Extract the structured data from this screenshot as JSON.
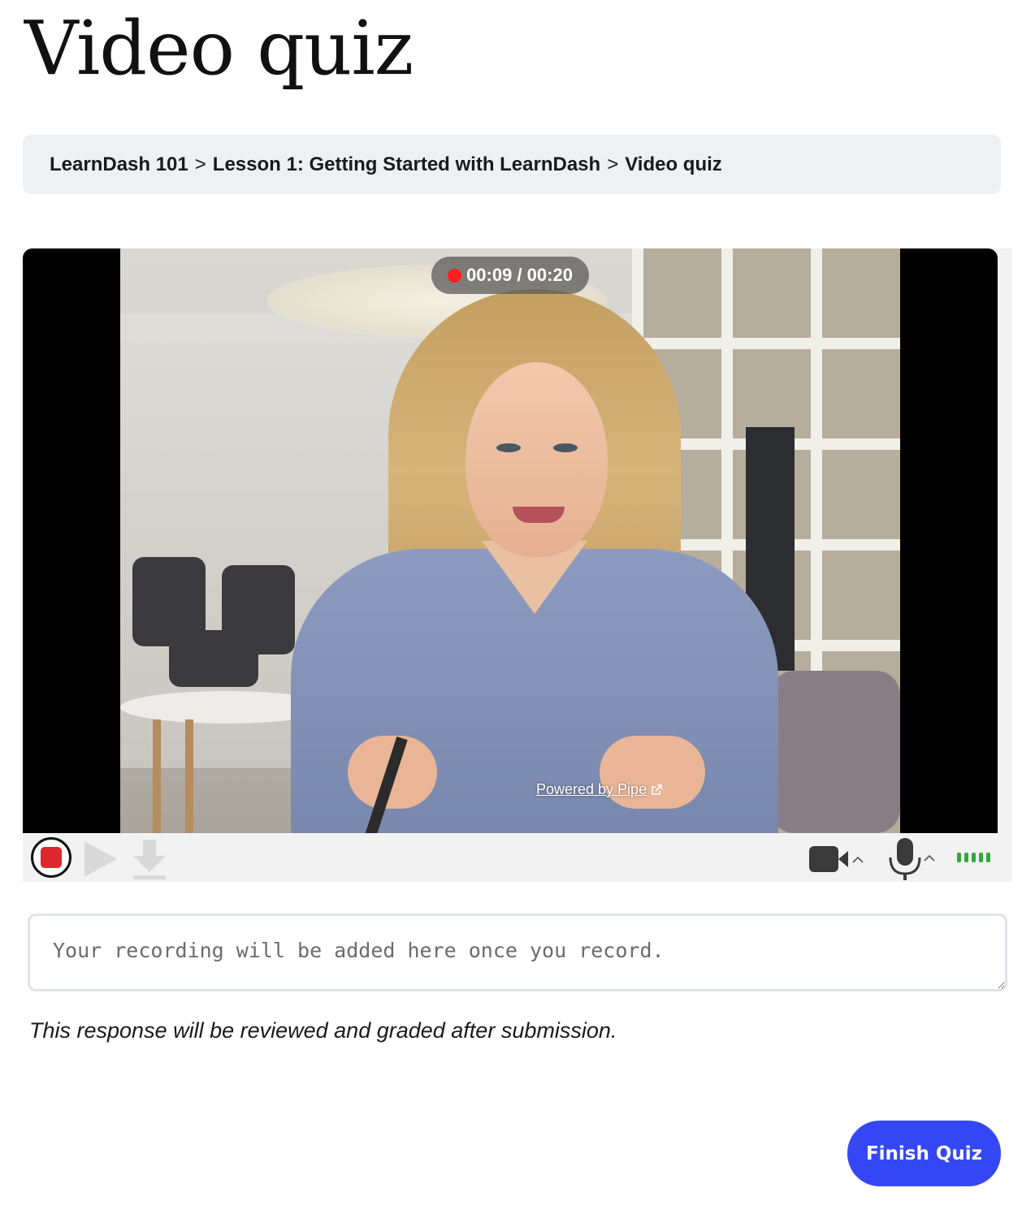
{
  "page": {
    "title": "Video quiz"
  },
  "breadcrumb": {
    "items": [
      "LearnDash 101",
      "Lesson 1: Getting Started with LearnDash",
      "Video quiz"
    ],
    "separator": ">"
  },
  "recorder": {
    "timer_elapsed": "00:09",
    "timer_total": "00:20",
    "timer_text": "00:09 / 00:20",
    "powered_by": "Powered by Pipe",
    "icons": {
      "record": "stop-record-icon",
      "play": "play-icon",
      "download": "download-icon",
      "camera": "camera-icon",
      "microphone": "microphone-icon",
      "level": "audio-level-icon"
    },
    "colors": {
      "record": "#e0262e",
      "timer_dot": "#ff1f1f",
      "audio_level": "#2eaa3c"
    }
  },
  "response": {
    "placeholder": "Your recording will be added here once you record.",
    "value": ""
  },
  "note": "This response will be reviewed and graded after submission.",
  "finish_button": {
    "label": "Finish Quiz",
    "color": "#3547f5"
  }
}
